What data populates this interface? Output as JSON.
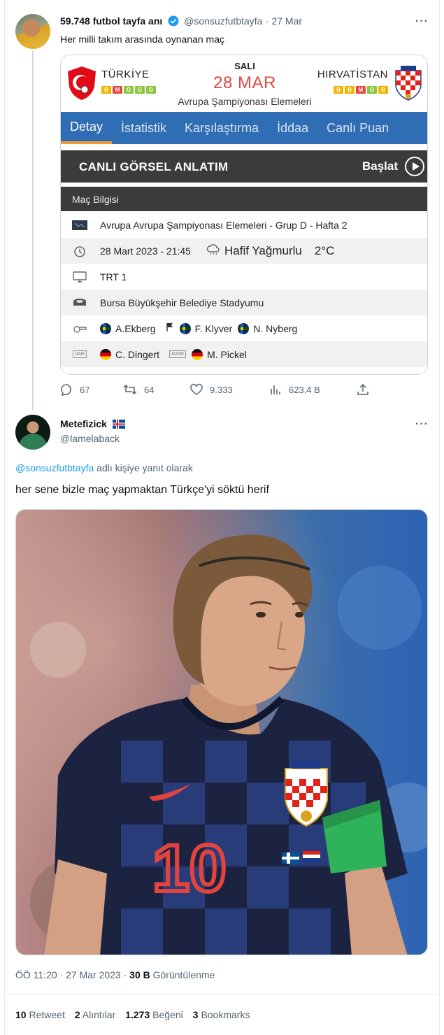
{
  "tweet1": {
    "name": "59.748 futbol tayfa anı",
    "handle": "@sonsuzfutbtayfa",
    "date": "· 27 Mar",
    "text": "Her milli takım arasında oynanan maç",
    "card": {
      "home_team": "TÜRKİYE",
      "away_team": "HIRVATİSTAN",
      "home_form": [
        "B",
        "M",
        "G",
        "G",
        "G"
      ],
      "away_form": [
        "B",
        "B",
        "M",
        "G",
        "B"
      ],
      "day": "SALI",
      "date": "28 MAR",
      "competition": "Avrupa Şampiyonası Elemeleri",
      "tabs": [
        "Detay",
        "İstatistik",
        "Karşılaştırma",
        "İddaa",
        "Canlı Puan"
      ],
      "live_title": "CANLI GÖRSEL ANLATIM",
      "live_start": "Başlat",
      "info_title": "Maç Bilgisi",
      "league": "Avrupa Avrupa Şampiyonası Elemeleri - Grup D - Hafta 2",
      "datetime": "28 Mart 2023 - 21:45",
      "weather": "Hafif Yağmurlu",
      "temperature": "2°C",
      "channel": "TRT 1",
      "stadium": "Bursa Büyükşehir Belediye Stadyumu",
      "referee_main": "A.Ekberg",
      "referee_assistant1": "F. Klyver",
      "referee_assistant2": "N. Nyberg",
      "var_label": "VAR",
      "var_ref": "C. Dingert",
      "avar_label": "AVAR",
      "avar_ref": "M. Pickel"
    },
    "actions": {
      "replies": "67",
      "retweets": "64",
      "likes": "9.333",
      "views": "623,4 B"
    }
  },
  "tweet2": {
    "name": "Metefizick",
    "handle": "@lamelaback",
    "reply_to_handle": "@sonsuzfutbtayfa",
    "reply_to_suffix": " adlı kişiye yanıt olarak",
    "text": "her sene bizle maç yapmaktan Türkçe'yi söktü herif",
    "time": "ÖÖ 11:20 · 27 Mar 2023 · ",
    "views_count": "30 B",
    "views_label": " Görüntülenme",
    "stats": {
      "retweets_count": "10",
      "retweets_label": "Retweet",
      "quotes_count": "2",
      "quotes_label": "Alıntılar",
      "likes_count": "1.273",
      "likes_label": "Beğeni",
      "bookmarks_count": "3",
      "bookmarks_label": "Bookmarks"
    }
  },
  "colors": {
    "accent": "#1d9bf0",
    "tab_bar": "#2f6db5",
    "match_date": "#e9453f"
  }
}
